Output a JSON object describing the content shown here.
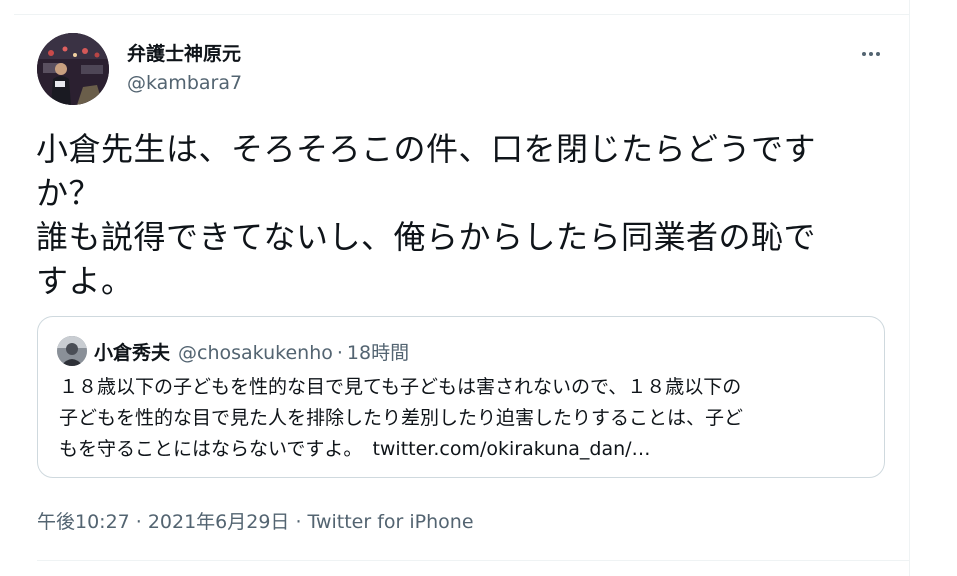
{
  "author": {
    "display_name": "弁護士神原元",
    "handle": "@kambara7"
  },
  "more_menu": {
    "icon": "more-horizontal-icon"
  },
  "tweet": {
    "text_lines": [
      "小倉先生は、そろそろこの件、口を閉じたらどうです",
      "か？",
      "誰も説得できてないし、俺らからしたら同業者の恥で",
      "すよ。"
    ]
  },
  "quote": {
    "display_name": "小倉秀夫",
    "handle": "@chosakukenho",
    "separator": "·",
    "time": "18時間",
    "text_lines": [
      "１８歳以下の子どもを性的な目で見ても子どもは害されないので、１８歳以下の",
      "子どもを性的な目で見た人を排除したり差別したり迫害したりすることは、子ど",
      "もを守ることにはならないですよ。"
    ],
    "link": "twitter.com/okirakuna_dan/…"
  },
  "meta": {
    "time": "午後10:27",
    "separator": "·",
    "date": "2021年6月29日",
    "source": "Twitter for iPhone"
  },
  "colors": {
    "text_primary": "#0f1419",
    "text_secondary": "#536471",
    "border": "#cfd9de",
    "divider": "#eff3f4"
  }
}
